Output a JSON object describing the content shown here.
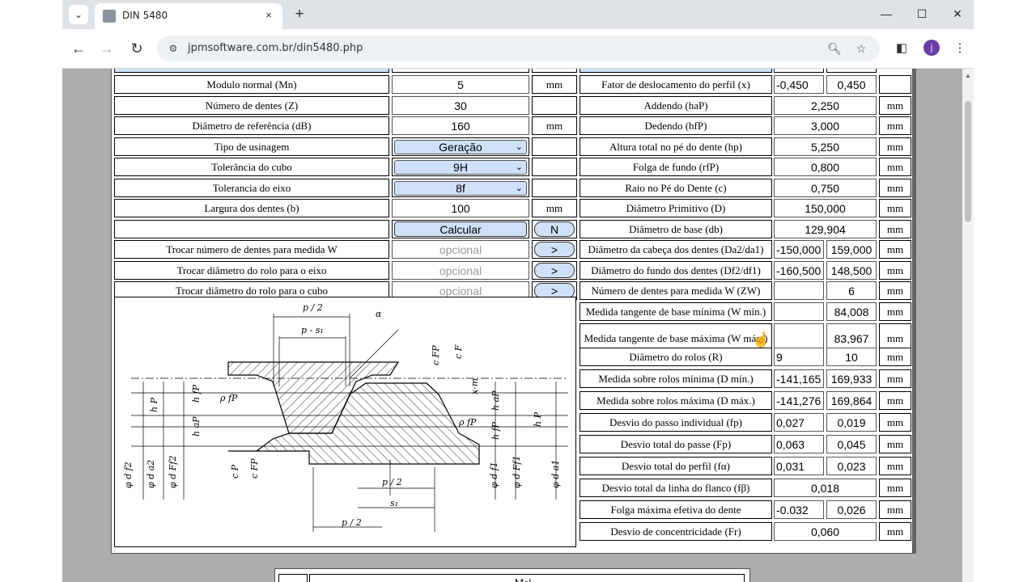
{
  "browser": {
    "tab_title": "DIN 5480",
    "tab_close": "×",
    "new_tab": "+",
    "url": "jpmsoftware.com.br/din5480.php",
    "profile_initial": "j",
    "minimize": "—",
    "maximize": "☐",
    "close": "✕"
  },
  "left_rows": [
    {
      "label": "Modulo normal (Mn)",
      "value": "5",
      "unit": "mm",
      "kind": "input"
    },
    {
      "label": "Número de dentes (Z)",
      "value": "30",
      "unit": "",
      "kind": "input"
    },
    {
      "label": "Diâmetro de referência (dB)",
      "value": "160",
      "unit": "mm",
      "kind": "input"
    },
    {
      "label": "Tipo de usinagem",
      "value": "Geração",
      "unit": "",
      "kind": "select"
    },
    {
      "label": "Tolerância do cubo",
      "value": "9H",
      "unit": "",
      "kind": "select"
    },
    {
      "label": "Tolerancia do eixo",
      "value": "8f",
      "unit": "",
      "kind": "select"
    },
    {
      "label": "Largura dos dentes (b)",
      "value": "100",
      "unit": "mm",
      "kind": "input"
    }
  ],
  "calc": {
    "button": "Calcular",
    "n_button": "N"
  },
  "swap_rows": [
    {
      "label": "Trocar número de dentes para medida W",
      "placeholder": "opcional",
      "button": ">"
    },
    {
      "label": "Trocar diâmetro do rolo para o eixo",
      "placeholder": "opcional",
      "button": ">"
    },
    {
      "label": "Trocar diâmetro do rolo para o cubo",
      "placeholder": "opcional",
      "button": ">"
    }
  ],
  "right_rows": [
    {
      "label": "Fator de deslocamento do perfil (x)",
      "v1": "-0,450",
      "v2": "0,450",
      "unit": ""
    },
    {
      "label": "Addendo (haP)",
      "v": "2,250",
      "unit": "mm"
    },
    {
      "label": "Dedendo (hfP)",
      "v": "3,000",
      "unit": "mm"
    },
    {
      "label": "Altura total no pé do dente (hp)",
      "v": "5,250",
      "unit": "mm"
    },
    {
      "label": "Folga de fundo (rfP)",
      "v": "0,800",
      "unit": "mm"
    },
    {
      "label": "Raio no Pé do Dente (c)",
      "v": "0,750",
      "unit": "mm"
    },
    {
      "label": "Diâmetro Primitivo (D)",
      "v": "150,000",
      "unit": "mm"
    },
    {
      "label": "Diâmetro de base (db)",
      "v": "129,904",
      "unit": "mm"
    },
    {
      "label": "Diâmetro da cabeça dos dentes (Da2/da1)",
      "v1": "-150,000",
      "v2": "159,000",
      "unit": "mm"
    },
    {
      "label": "Diâmetro do fundo dos dentes (Df2/df1)",
      "v1": "-160,500",
      "v2": "148,500",
      "unit": "mm"
    },
    {
      "label": "Número de dentes para medida W (ZW)",
      "v1": "",
      "v2": "6",
      "unit": "mm"
    },
    {
      "label": "Medida tangente de base mínima (W mín.)",
      "v1": "",
      "v2": "84,008",
      "unit": "mm"
    },
    {
      "label": "Medida tangente de base máxima (W máx.)",
      "v1": "",
      "v2": "83,967",
      "unit": "mm"
    },
    {
      "label": "Diâmetro do rolos (R)",
      "v1": "9",
      "v2": "10",
      "unit": "mm"
    },
    {
      "label": "Medida sobre rolos mínima (D mín.)",
      "v1": "-141,165",
      "v2": "169,933",
      "unit": "mm"
    },
    {
      "label": "Medida sobre rolos máxima (D máx.)",
      "v1": "-141,276",
      "v2": "169,864",
      "unit": "mm"
    },
    {
      "label": "Desvio do passo individual (fp)",
      "v1": "0,027",
      "v2": "0,019",
      "unit": "mm"
    },
    {
      "label": "Desvio total do passe (Fp)",
      "v1": "0,063",
      "v2": "0,045",
      "unit": "mm"
    },
    {
      "label": "Desvio total do perfil (fα)",
      "v1": "0,031",
      "v2": "0,023",
      "unit": "mm"
    },
    {
      "label": "Desvio total da linha do flanco (fβ)",
      "v": "0,018",
      "unit": "mm"
    },
    {
      "label": "Folga máxima efetiva do dente",
      "v1": "-0.032",
      "v2": "0,026",
      "unit": "mm"
    },
    {
      "label": "Desvio de concentricidade (Fr)",
      "v": "0,060",
      "unit": "mm"
    }
  ],
  "diagram": {
    "labels": [
      "p / 2",
      "p - s",
      "1",
      "α",
      "c",
      "FP",
      "c",
      "F",
      "x·m",
      "ρ",
      "fP",
      "h",
      "P",
      "h",
      "fP",
      "h",
      "aP",
      "h",
      "aP",
      "h",
      "fP",
      "h",
      "P",
      "c",
      "P",
      "c",
      "FP",
      "φ d",
      "f2",
      "φ d",
      "a2",
      "φ d",
      "Ff2",
      "φ d",
      "f1",
      "φ d",
      "Ff1",
      "φ d",
      "a1",
      "p / 2",
      "s",
      "1",
      "p / 2"
    ]
  },
  "below_text": "Mel..."
}
